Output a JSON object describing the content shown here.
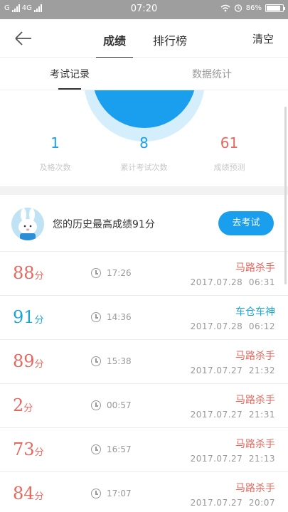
{
  "status_bar": {
    "carrier_left": "G",
    "network": "4G",
    "time": "07:20",
    "battery_percent": "86%",
    "battery_level": 0.86,
    "icons": [
      "signal-icon",
      "alarm-icon",
      "wifi-icon",
      "battery-icon"
    ]
  },
  "nav": {
    "tabs": [
      {
        "label": "成绩",
        "active": true
      },
      {
        "label": "排行榜",
        "active": false
      }
    ],
    "clear_label": "清空",
    "back_icon": "arrow-left-icon"
  },
  "subtabs": [
    {
      "label": "考试记录",
      "active": true
    },
    {
      "label": "数据统计",
      "active": false
    }
  ],
  "stats": [
    {
      "value": "1",
      "label": "及格次数"
    },
    {
      "value": "8",
      "label": "累计考试次数"
    },
    {
      "value": "61",
      "label": "成绩预测"
    }
  ],
  "best": {
    "text": "您的历史最高成绩91分",
    "button_label": "去考试"
  },
  "records": [
    {
      "score": "88",
      "unit": "分",
      "duration": "17:26",
      "level": "马路杀手",
      "date": "2017.07.28  06:31",
      "highlight": false
    },
    {
      "score": "91",
      "unit": "分",
      "duration": "14:36",
      "level": "车仓车神",
      "date": "2017.07.28  06:12",
      "highlight": true
    },
    {
      "score": "89",
      "unit": "分",
      "duration": "15:38",
      "level": "马路杀手",
      "date": "2017.07.27  21:32",
      "highlight": false
    },
    {
      "score": "2",
      "unit": "分",
      "duration": "00:57",
      "level": "马路杀手",
      "date": "2017.07.27  21:31",
      "highlight": false
    },
    {
      "score": "73",
      "unit": "分",
      "duration": "16:57",
      "level": "马路杀手",
      "date": "2017.07.27  21:13",
      "highlight": false
    },
    {
      "score": "84",
      "unit": "分",
      "duration": "17:07",
      "level": "马路杀手",
      "date": "2017.07.27  20:07",
      "highlight": false
    }
  ],
  "colors": {
    "accent": "#1a9fee",
    "score_red": "#e8685e",
    "score_blue": "#1aa5d8",
    "status_bar": "#9e9e9e"
  }
}
